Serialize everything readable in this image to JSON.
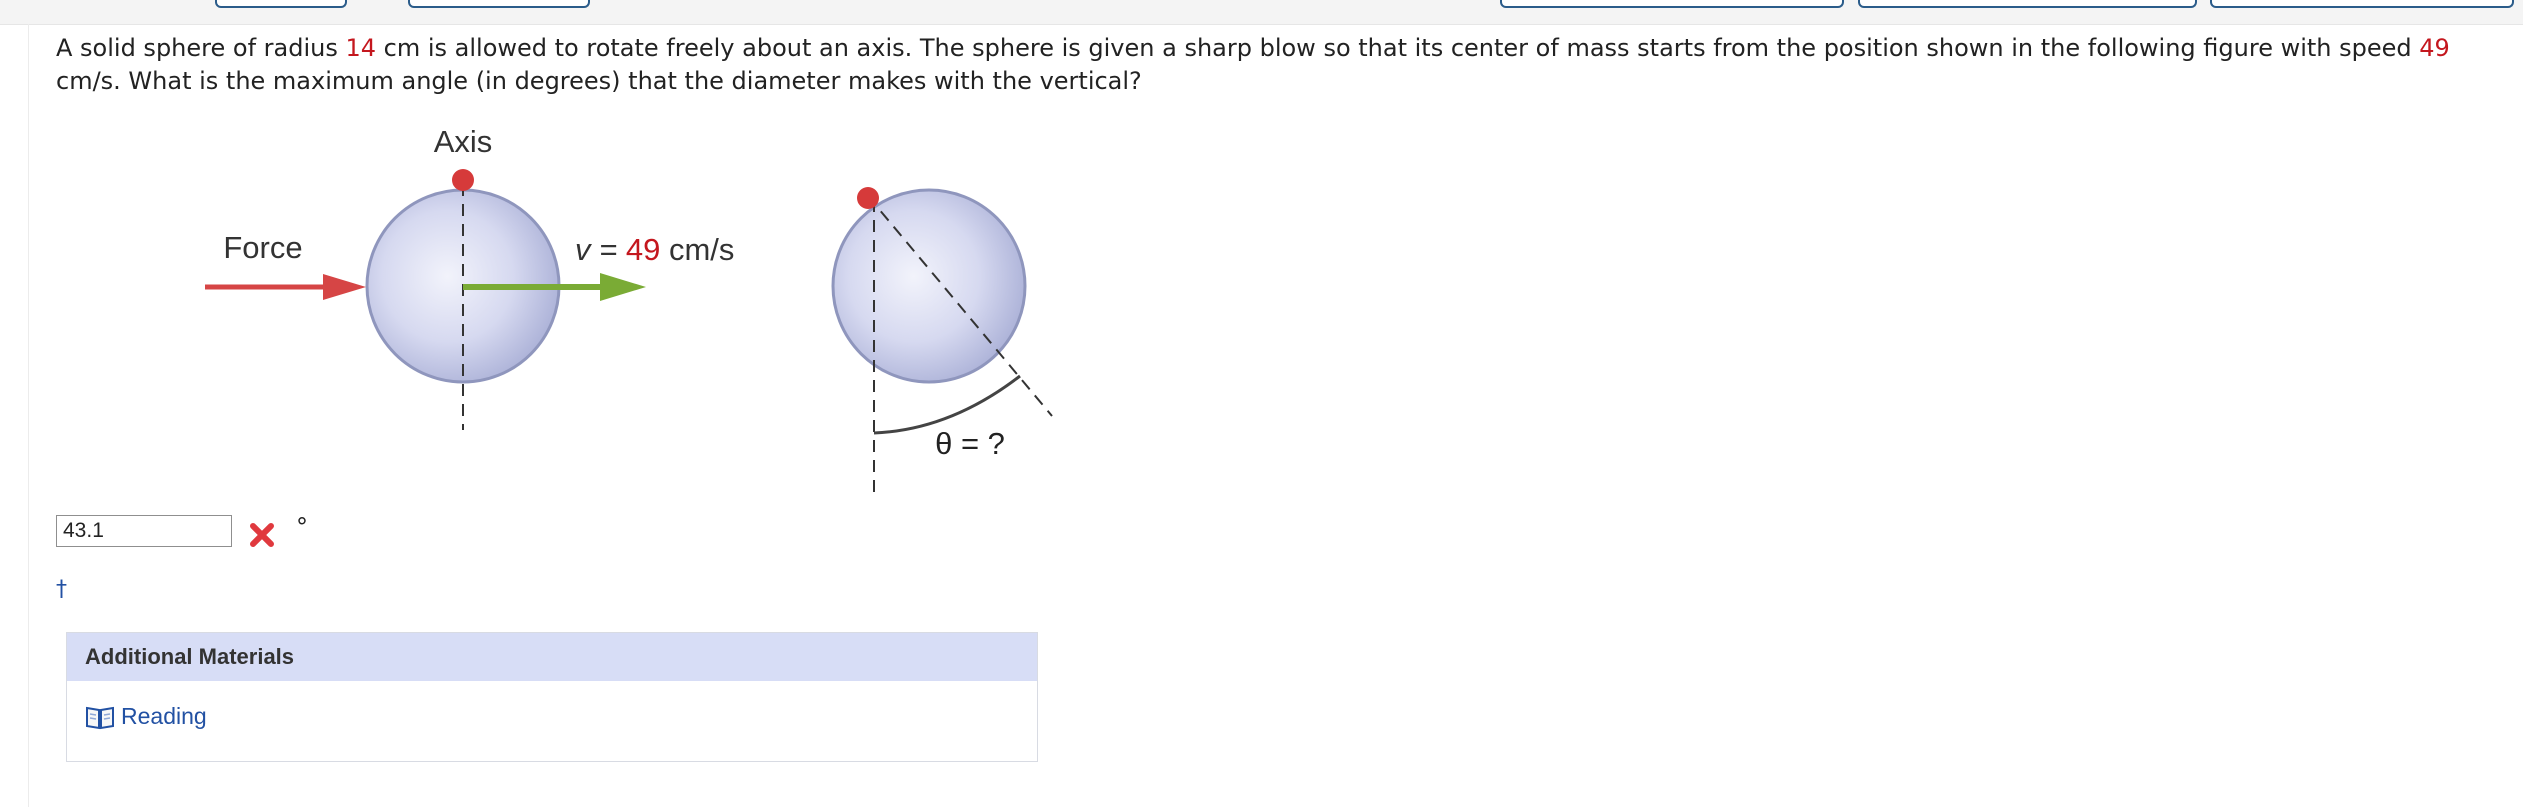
{
  "question": {
    "part1": "A solid sphere of radius ",
    "radius": "14",
    "part2": " cm is allowed to rotate freely about an axis. The sphere is given a sharp blow so that its center of mass starts from the position shown in the following figure with speed ",
    "speed": "49",
    "part3": " cm/s. What is the maximum angle (in degrees) that the diameter makes with the vertical?"
  },
  "figure": {
    "axis_label": "Axis",
    "force_label": "Force",
    "velocity_prefix": "v = ",
    "velocity_value": "49",
    "velocity_unit": " cm/s",
    "theta_label": "θ = ?"
  },
  "answer": {
    "value": "43.1",
    "unit": "°",
    "status_icon": "x-icon"
  },
  "dagger": "†",
  "additional_materials": {
    "title": "Additional Materials",
    "reading_label": "Reading",
    "reading_icon": "book-icon"
  },
  "colors": {
    "accent_red": "#c4171e",
    "link_blue": "#2251a3",
    "panel_header": "#d7ddf6",
    "force_arrow": "#d64545",
    "velocity_arrow": "#7aab35"
  }
}
